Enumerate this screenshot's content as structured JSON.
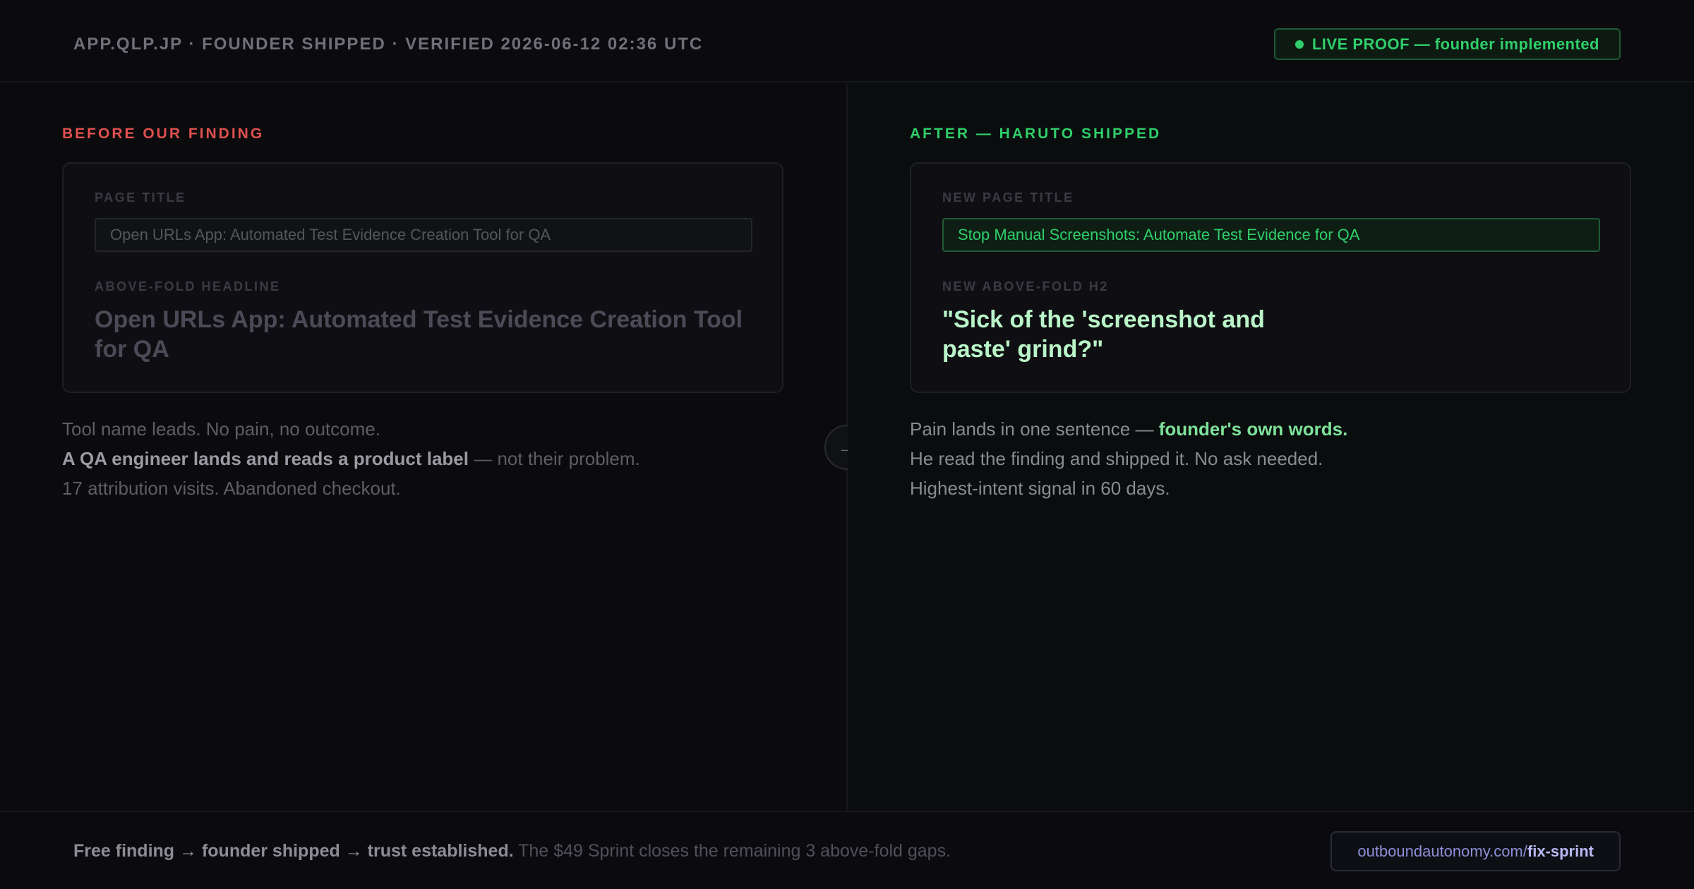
{
  "header": {
    "meta": "APP.QLP.JP · FOUNDER SHIPPED · VERIFIED 2026-06-12 02:36 UTC",
    "badge": "LIVE PROOF — founder implemented"
  },
  "before": {
    "section_label": "BEFORE OUR FINDING",
    "title_label": "PAGE TITLE",
    "title_value": "Open URLs App: Automated Test Evidence Creation Tool for QA",
    "headline_label": "ABOVE-FOLD HEADLINE",
    "headline": "Open URLs App: Automated Test Evidence Creation Tool for QA",
    "notes": {
      "line1": "Tool name leads. No pain, no outcome.",
      "line2_bold": "A QA engineer lands and reads a product label",
      "line2_rest": " — not their problem.",
      "line3": "17 attribution visits. Abandoned checkout."
    }
  },
  "after": {
    "section_label": "AFTER — HARUTO SHIPPED",
    "title_label": "NEW PAGE TITLE",
    "title_value": "Stop Manual Screenshots: Automate Test Evidence for QA",
    "headline_label": "NEW ABOVE-FOLD H2",
    "headline": "\"Sick of the 'screenshot and paste' grind?\"",
    "notes": {
      "line1_start": "Pain lands in one sentence — ",
      "line1_bold": "founder's own words.",
      "line2": "He read the finding and shipped it. No ask needed.",
      "line3": "Highest-intent signal in 60 days."
    }
  },
  "arrow": "→",
  "footer": {
    "bold": "Free finding → founder shipped → trust established.",
    "rest": " The $49 Sprint closes the remaining 3 above-fold gaps.",
    "cta_domain": "outboundautonomy.com/",
    "cta_path": "fix-sprint"
  },
  "colors": {
    "background": "#0a0a0c",
    "before_accent": "#e0514f",
    "after_accent": "#2fcf6a",
    "cta_accent": "#8a8fd8"
  }
}
